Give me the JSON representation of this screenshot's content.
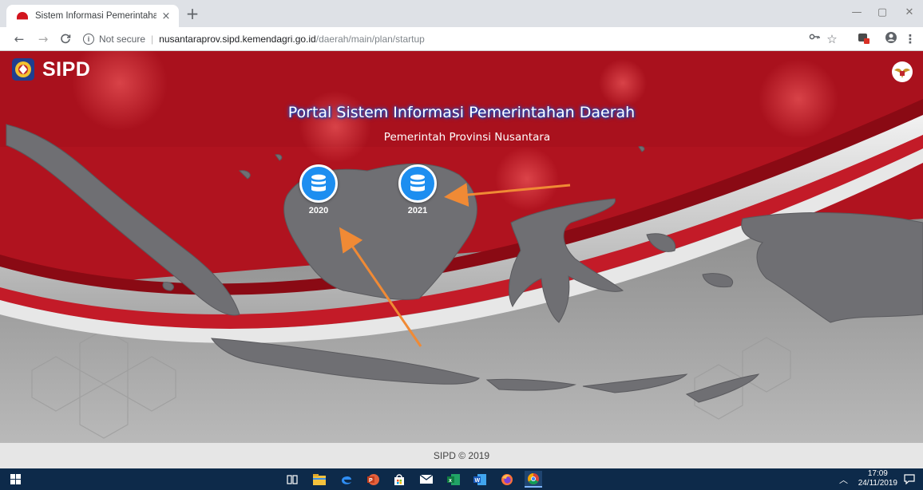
{
  "browser": {
    "tab_title": "Sistem Informasi Pemerintahan D",
    "tab_close": "×",
    "new_tab": "+",
    "not_secure": "Not secure",
    "url_host": "nusantaraprov.sipd.kemendagri.go.id",
    "url_path": "/daerah/main/plan/startup",
    "window_controls": [
      "—",
      "▢",
      "✕"
    ]
  },
  "header": {
    "logo_text": "SIPD"
  },
  "hero": {
    "title": "Portal Sistem Informasi Pemerintahan Daerah",
    "subtitle": "Pemerintah Provinsi Nusantara"
  },
  "years": [
    {
      "label": "2020",
      "icon": "database-icon"
    },
    {
      "label": "2021",
      "icon": "database-icon"
    }
  ],
  "colors": {
    "brand_red": "#b51623",
    "button_blue": "#1d8ef0",
    "annotation_orange": "#f08a35"
  },
  "footer": {
    "text": "SIPD © 2019"
  },
  "taskbar": {
    "time": "17:09",
    "date": "24/11/2019"
  }
}
